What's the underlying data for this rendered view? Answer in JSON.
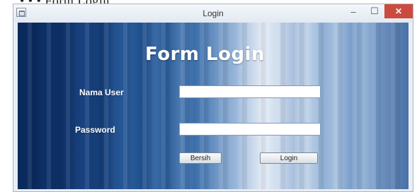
{
  "document_fragment": {
    "text": "• • •   Form Login"
  },
  "window": {
    "title": "Login",
    "controls": {
      "minimize": "–",
      "maximize": "☐",
      "close": "✕"
    }
  },
  "form": {
    "title": "Form Login",
    "username_label": "Nama User",
    "username_value": "",
    "password_label": "Password",
    "password_value": "",
    "clear_button": "Bersih",
    "login_button": "Login"
  },
  "colors": {
    "background_dark": "#0a2a5c",
    "background_light": "#e4ecf6",
    "close_button": "#cc4b3f"
  },
  "icons": [
    "app-icon",
    "minimize-icon",
    "maximize-icon",
    "close-icon"
  ]
}
